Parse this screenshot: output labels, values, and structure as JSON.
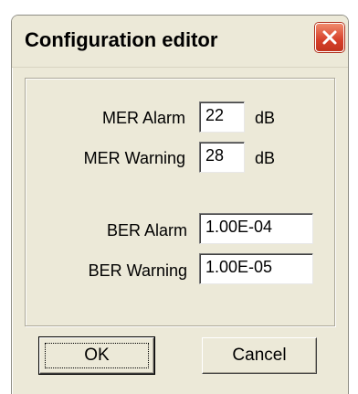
{
  "window": {
    "title": "Configuration editor"
  },
  "icons": {
    "close": "close-icon"
  },
  "colors": {
    "dialog_bg": "#ece9d8",
    "close_button": "#d6402a"
  },
  "fields": {
    "mer_alarm": {
      "label": "MER Alarm",
      "value": "22",
      "unit": "dB"
    },
    "mer_warning": {
      "label": "MER Warning",
      "value": "28",
      "unit": "dB"
    },
    "ber_alarm": {
      "label": "BER Alarm",
      "value": "1.00E-04"
    },
    "ber_warning": {
      "label": "BER Warning",
      "value": "1.00E-05"
    }
  },
  "buttons": {
    "ok": "OK",
    "cancel": "Cancel"
  }
}
